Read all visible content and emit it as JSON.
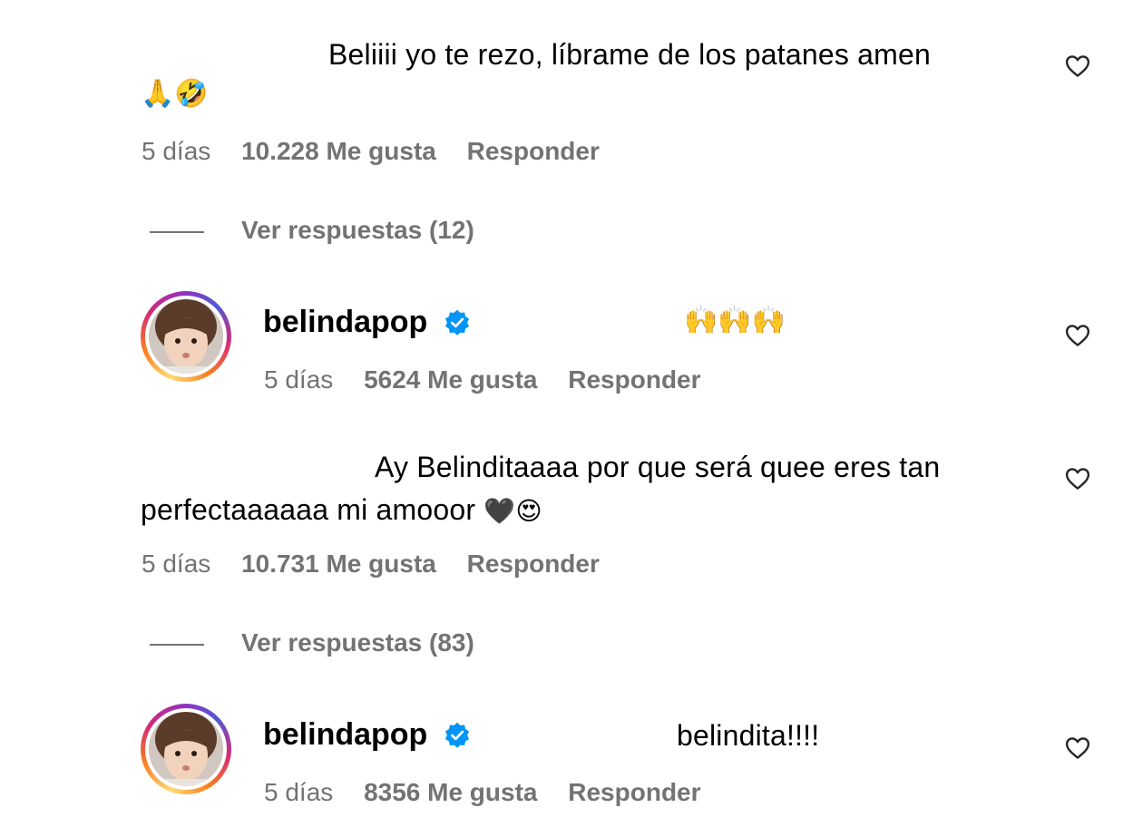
{
  "comments": [
    {
      "text_line1": "Beliiii yo te rezo, líbrame de los patanes amen",
      "text_line2_emoji": "🙏🤣",
      "time": "5 días",
      "likes": "10.228 Me gusta",
      "reply": "Responder",
      "view_replies": "Ver respuestas (12)"
    },
    {
      "username": "belindapop",
      "text_emoji": "🙌🙌🙌",
      "time": "5 días",
      "likes": "5624 Me gusta",
      "reply": "Responder"
    },
    {
      "text_line1": "Ay Belinditaaaa por que será quee eres tan",
      "text_line2": "perfectaaaaaa mi amooor",
      "text_line2_emoji": "🖤😍",
      "time": "5 días",
      "likes": "10.731 Me gusta",
      "reply": "Responder",
      "view_replies": "Ver respuestas (83)"
    },
    {
      "username": "belindapop",
      "text": "belindita!!!!",
      "time": "5 días",
      "likes": "8356 Me gusta",
      "reply": "Responder"
    }
  ],
  "colors": {
    "meta": "#737373",
    "verified": "#0095f6"
  },
  "icons": {
    "like": "heart-outline-icon",
    "verified": "verified-badge-icon"
  }
}
